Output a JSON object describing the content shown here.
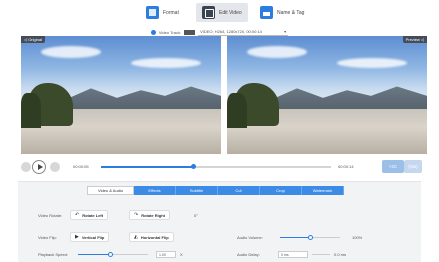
{
  "top_tabs": [
    {
      "label": "Format",
      "icon": "format-icon"
    },
    {
      "label": "Edit Video",
      "icon": "edit-video-icon",
      "active": true
    },
    {
      "label": "Name & Tag",
      "icon": "name-tag-icon"
    }
  ],
  "video_track": {
    "label": "Video Track:",
    "value": "VIDEO; H264, 1280x720, 00:00:14",
    "dropdown_glyph": "▾"
  },
  "preview": {
    "left_badge": "◁ Original",
    "right_badge": "Preview ◁"
  },
  "playback": {
    "current_time": "00:00:05",
    "total_time": "00:00:14",
    "progress_fraction": 0.4,
    "btn_primary": "+2C",
    "btn_secondary": "(Sw)"
  },
  "edit_tabs": [
    {
      "label": "Video & Audio",
      "active": true
    },
    {
      "label": "Effects"
    },
    {
      "label": "Subtitle"
    },
    {
      "label": "Cut"
    },
    {
      "label": "Crop"
    },
    {
      "label": "Watermark"
    }
  ],
  "rotate": {
    "label": "Video Rotate:",
    "left": "Rotate Left",
    "right": "Rotate Right",
    "degree": "0°"
  },
  "flip": {
    "label": "Video Flip:",
    "vertical": "Vertical Flip",
    "horizontal": "Horizontal Flip"
  },
  "audio_volume": {
    "label": "Audio Volume:",
    "value": "100%",
    "level_fraction": 0.5
  },
  "playback_speed": {
    "label": "Playback Speed:",
    "value": "1.00",
    "unit": "X",
    "level_fraction": 0.45
  },
  "audio_delay": {
    "label": "Audio Delay:",
    "value": "0 ms",
    "suffix": "0.0 ms"
  },
  "colors": {
    "accent": "#2b7de1",
    "tab_blue": "#3c8be6"
  }
}
